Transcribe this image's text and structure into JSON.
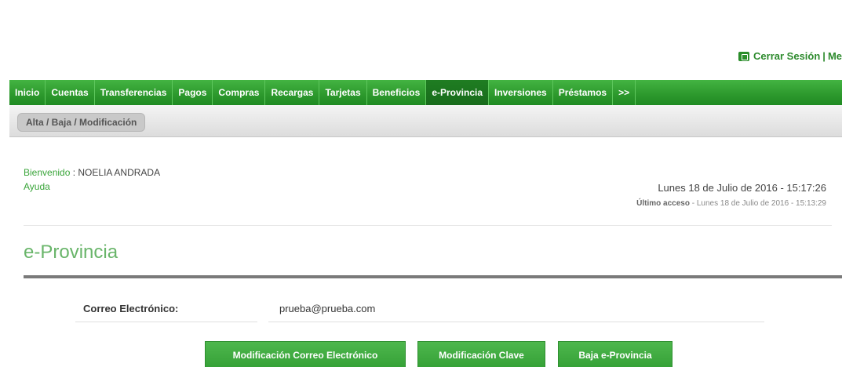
{
  "session": {
    "logout_label": "Cerrar Sesión",
    "separator": "|",
    "menu_label": "Me"
  },
  "nav": {
    "items": [
      {
        "label": "Inicio"
      },
      {
        "label": "Cuentas"
      },
      {
        "label": "Transferencias"
      },
      {
        "label": "Pagos"
      },
      {
        "label": "Compras"
      },
      {
        "label": "Recargas"
      },
      {
        "label": "Tarjetas"
      },
      {
        "label": "Beneficios"
      },
      {
        "label": "e-Provincia"
      },
      {
        "label": "Inversiones"
      },
      {
        "label": "Préstamos"
      },
      {
        "label": ">>"
      }
    ],
    "active": "e-Provincia"
  },
  "subnav": {
    "tab_label": "Alta / Baja / Modificación"
  },
  "user": {
    "welcome_label": "Bienvenido",
    "name": " : NOELIA ANDRADA",
    "help_label": "Ayuda",
    "datetime": "Lunes 18 de Julio de 2016 - 15:17:26",
    "last_access_label": "Último acceso",
    "last_access_value": " - Lunes 18 de Julio de 2016 - 15:13:29"
  },
  "section": {
    "title": "e-Provincia"
  },
  "form": {
    "email_label": "Correo Electrónico:",
    "email_value": "prueba@prueba.com"
  },
  "buttons": {
    "modify_email": "Modificación Correo Electrónico",
    "modify_password": "Modificación Clave",
    "unsubscribe": "Baja e-Provincia"
  },
  "colors": {
    "brand_green": "#2e9a2e",
    "text_green": "#3aa53a",
    "title_green": "#69b56a"
  }
}
